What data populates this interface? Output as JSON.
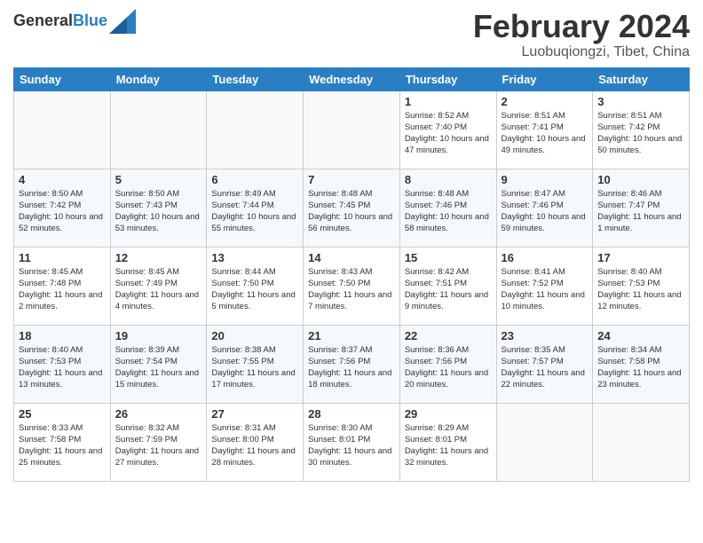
{
  "logo": {
    "line1": "General",
    "line2": "Blue"
  },
  "title": "February 2024",
  "subtitle": "Luobuqiongzi, Tibet, China",
  "weekdays": [
    "Sunday",
    "Monday",
    "Tuesday",
    "Wednesday",
    "Thursday",
    "Friday",
    "Saturday"
  ],
  "weeks": [
    [
      {
        "day": "",
        "info": ""
      },
      {
        "day": "",
        "info": ""
      },
      {
        "day": "",
        "info": ""
      },
      {
        "day": "",
        "info": ""
      },
      {
        "day": "1",
        "info": "Sunrise: 8:52 AM\nSunset: 7:40 PM\nDaylight: 10 hours\nand 47 minutes."
      },
      {
        "day": "2",
        "info": "Sunrise: 8:51 AM\nSunset: 7:41 PM\nDaylight: 10 hours\nand 49 minutes."
      },
      {
        "day": "3",
        "info": "Sunrise: 8:51 AM\nSunset: 7:42 PM\nDaylight: 10 hours\nand 50 minutes."
      }
    ],
    [
      {
        "day": "4",
        "info": "Sunrise: 8:50 AM\nSunset: 7:42 PM\nDaylight: 10 hours\nand 52 minutes."
      },
      {
        "day": "5",
        "info": "Sunrise: 8:50 AM\nSunset: 7:43 PM\nDaylight: 10 hours\nand 53 minutes."
      },
      {
        "day": "6",
        "info": "Sunrise: 8:49 AM\nSunset: 7:44 PM\nDaylight: 10 hours\nand 55 minutes."
      },
      {
        "day": "7",
        "info": "Sunrise: 8:48 AM\nSunset: 7:45 PM\nDaylight: 10 hours\nand 56 minutes."
      },
      {
        "day": "8",
        "info": "Sunrise: 8:48 AM\nSunset: 7:46 PM\nDaylight: 10 hours\nand 58 minutes."
      },
      {
        "day": "9",
        "info": "Sunrise: 8:47 AM\nSunset: 7:46 PM\nDaylight: 10 hours\nand 59 minutes."
      },
      {
        "day": "10",
        "info": "Sunrise: 8:46 AM\nSunset: 7:47 PM\nDaylight: 11 hours\nand 1 minute."
      }
    ],
    [
      {
        "day": "11",
        "info": "Sunrise: 8:45 AM\nSunset: 7:48 PM\nDaylight: 11 hours\nand 2 minutes."
      },
      {
        "day": "12",
        "info": "Sunrise: 8:45 AM\nSunset: 7:49 PM\nDaylight: 11 hours\nand 4 minutes."
      },
      {
        "day": "13",
        "info": "Sunrise: 8:44 AM\nSunset: 7:50 PM\nDaylight: 11 hours\nand 5 minutes."
      },
      {
        "day": "14",
        "info": "Sunrise: 8:43 AM\nSunset: 7:50 PM\nDaylight: 11 hours\nand 7 minutes."
      },
      {
        "day": "15",
        "info": "Sunrise: 8:42 AM\nSunset: 7:51 PM\nDaylight: 11 hours\nand 9 minutes."
      },
      {
        "day": "16",
        "info": "Sunrise: 8:41 AM\nSunset: 7:52 PM\nDaylight: 11 hours\nand 10 minutes."
      },
      {
        "day": "17",
        "info": "Sunrise: 8:40 AM\nSunset: 7:53 PM\nDaylight: 11 hours\nand 12 minutes."
      }
    ],
    [
      {
        "day": "18",
        "info": "Sunrise: 8:40 AM\nSunset: 7:53 PM\nDaylight: 11 hours\nand 13 minutes."
      },
      {
        "day": "19",
        "info": "Sunrise: 8:39 AM\nSunset: 7:54 PM\nDaylight: 11 hours\nand 15 minutes."
      },
      {
        "day": "20",
        "info": "Sunrise: 8:38 AM\nSunset: 7:55 PM\nDaylight: 11 hours\nand 17 minutes."
      },
      {
        "day": "21",
        "info": "Sunrise: 8:37 AM\nSunset: 7:56 PM\nDaylight: 11 hours\nand 18 minutes."
      },
      {
        "day": "22",
        "info": "Sunrise: 8:36 AM\nSunset: 7:56 PM\nDaylight: 11 hours\nand 20 minutes."
      },
      {
        "day": "23",
        "info": "Sunrise: 8:35 AM\nSunset: 7:57 PM\nDaylight: 11 hours\nand 22 minutes."
      },
      {
        "day": "24",
        "info": "Sunrise: 8:34 AM\nSunset: 7:58 PM\nDaylight: 11 hours\nand 23 minutes."
      }
    ],
    [
      {
        "day": "25",
        "info": "Sunrise: 8:33 AM\nSunset: 7:58 PM\nDaylight: 11 hours\nand 25 minutes."
      },
      {
        "day": "26",
        "info": "Sunrise: 8:32 AM\nSunset: 7:59 PM\nDaylight: 11 hours\nand 27 minutes."
      },
      {
        "day": "27",
        "info": "Sunrise: 8:31 AM\nSunset: 8:00 PM\nDaylight: 11 hours\nand 28 minutes."
      },
      {
        "day": "28",
        "info": "Sunrise: 8:30 AM\nSunset: 8:01 PM\nDaylight: 11 hours\nand 30 minutes."
      },
      {
        "day": "29",
        "info": "Sunrise: 8:29 AM\nSunset: 8:01 PM\nDaylight: 11 hours\nand 32 minutes."
      },
      {
        "day": "",
        "info": ""
      },
      {
        "day": "",
        "info": ""
      }
    ]
  ]
}
